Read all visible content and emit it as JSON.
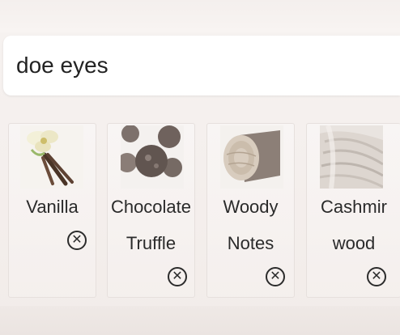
{
  "search": {
    "value": "doe eyes"
  },
  "notes": [
    {
      "line1": "Vanilla",
      "line2": "",
      "icon": "vanilla-icon"
    },
    {
      "line1": "Chocolate",
      "line2": "Truffle",
      "icon": "chocolate-truffle-icon"
    },
    {
      "line1": "Woody",
      "line2": "Notes",
      "icon": "woody-notes-icon"
    },
    {
      "line1": "Cashmir",
      "line2": "wood",
      "icon": "cashmere-wood-icon"
    }
  ],
  "remove_icon": "close-circle-icon",
  "remove_glyph": "✕"
}
